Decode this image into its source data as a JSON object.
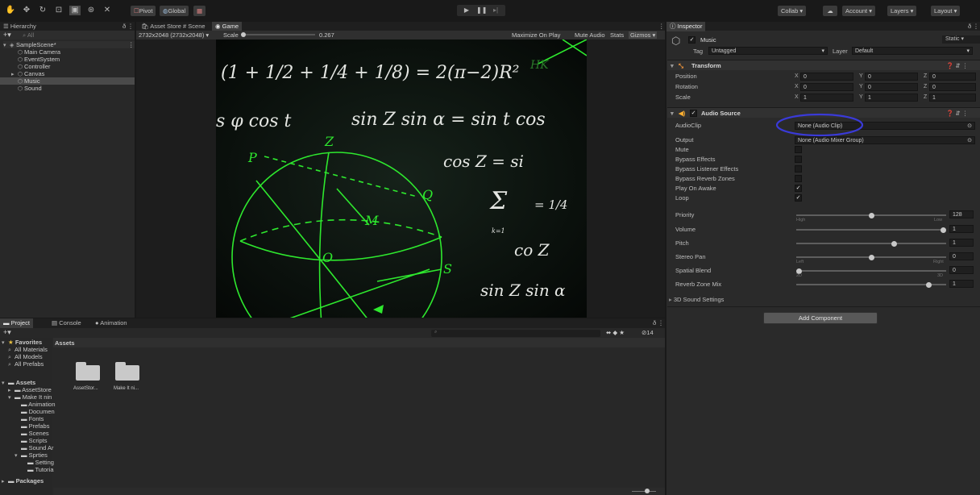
{
  "toolbar": {
    "tools": [
      "hand-tool-icon",
      "move-tool-icon",
      "rotate-tool-icon",
      "scale-tool-icon",
      "rect-tool-icon",
      "transform-tool-icon",
      "custom-tool-icon"
    ],
    "pivot": "Pivot",
    "global": "Global",
    "collab": "Collab ▾",
    "account": "Account",
    "layers": "Layers",
    "layout": "Layout"
  },
  "hierarchy": {
    "tab": "Hierarchy",
    "search_placeholder": "All",
    "scene": "SampleScene*",
    "items": [
      "Main Camera",
      "EventSystem",
      "Controller",
      "Canvas",
      "Music",
      "Sound"
    ]
  },
  "center_tabs": {
    "asset_store": "Asset Store",
    "scene": "Scene",
    "game": "Game"
  },
  "game_bar": {
    "resolution": "2732x2048 (2732x2048)",
    "scale_label": "Scale",
    "scale_value": "0.267",
    "maximize": "Maximize On Play",
    "mute": "Mute Audio",
    "stats": "Stats",
    "gizmos": "Gizmos"
  },
  "game_view": {
    "formula1": "(1 + 1/2 + 1/4 + 1/8) = 2(π−2)R²",
    "hk": "HK",
    "formula2a": "s φ cos t",
    "formula2b": "sin Z sin α = sin t cos",
    "formula3": "cos Z = si",
    "sigma": "Σ",
    "frac": "= 1/4",
    "k1": "k=1",
    "formula4": "co Z",
    "formula5": "sin Z sin α",
    "label_z": "Z",
    "label_p": "P",
    "label_q": "Q",
    "label_m": "M",
    "label_o": "O",
    "label_s": "S"
  },
  "inspector": {
    "tab": "Inspector",
    "object_name": "Music",
    "static": "Static",
    "tag_label": "Tag",
    "tag_value": "Untagged",
    "layer_label": "Layer",
    "layer_value": "Default",
    "transform": {
      "title": "Transform",
      "position": "Position",
      "rotation": "Rotation",
      "scale": "Scale",
      "pos": [
        "0",
        "0",
        "0"
      ],
      "rot": [
        "0",
        "0",
        "0"
      ],
      "scl": [
        "1",
        "1",
        "1"
      ]
    },
    "audio": {
      "title": "Audio Source",
      "audioclip_label": "AudioClip",
      "audioclip_value": "None (Audio Clip)",
      "output_label": "Output",
      "output_value": "None (Audio Mixer Group)",
      "mute": "Mute",
      "bypass_effects": "Bypass Effects",
      "bypass_listener": "Bypass Listener Effects",
      "bypass_reverb": "Bypass Reverb Zones",
      "play_on_awake": "Play On Awake",
      "loop": "Loop",
      "priority": "Priority",
      "priority_value": "128",
      "priority_fraction": 0.5,
      "high": "High",
      "low": "Low",
      "volume": "Volume",
      "volume_value": "1",
      "volume_fraction": 1.0,
      "pitch": "Pitch",
      "pitch_value": "1",
      "pitch_fraction": 0.66,
      "stereo_pan": "Stereo Pan",
      "stereo_pan_value": "0",
      "stereo_pan_fraction": 0.5,
      "left": "Left",
      "right": "Right",
      "spatial_blend": "Spatial Blend",
      "spatial_blend_value": "0",
      "spatial_blend_fraction": 0.0,
      "two_d": "2D",
      "three_d": "3D",
      "reverb_mix": "Reverb Zone Mix",
      "reverb_mix_value": "1",
      "reverb_mix_fraction": 0.9,
      "sound_settings": "3D Sound Settings"
    },
    "add_component": "Add Component"
  },
  "project": {
    "tab_project": "Project",
    "tab_console": "Console",
    "tab_animation": "Animation",
    "favorites": "Favorites",
    "fav_items": [
      "All Materials",
      "All Models",
      "All Prefabs"
    ],
    "assets_root": "Assets",
    "tree": [
      "AssetStore",
      "Make It nin",
      "Animation",
      "Documen",
      "Fonts",
      "Prefabs",
      "Scenes",
      "Scripts",
      "Sound Ar",
      "Sprties",
      "Setting",
      "Tutoria"
    ],
    "packages": "Packages",
    "breadcrumb": "Assets",
    "folders": [
      "AssetStor...",
      "Make It ni..."
    ],
    "hidden_count": "14"
  }
}
